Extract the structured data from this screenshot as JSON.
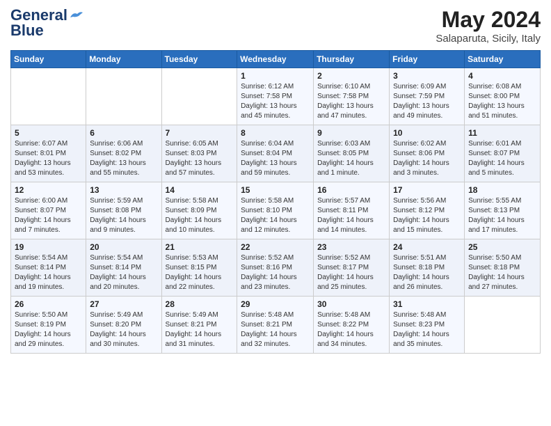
{
  "logo": {
    "line1": "General",
    "line2": "Blue"
  },
  "title": "May 2024",
  "subtitle": "Salaparuta, Sicily, Italy",
  "weekdays": [
    "Sunday",
    "Monday",
    "Tuesday",
    "Wednesday",
    "Thursday",
    "Friday",
    "Saturday"
  ],
  "weeks": [
    [
      {
        "day": "",
        "info": ""
      },
      {
        "day": "",
        "info": ""
      },
      {
        "day": "",
        "info": ""
      },
      {
        "day": "1",
        "info": "Sunrise: 6:12 AM\nSunset: 7:58 PM\nDaylight: 13 hours\nand 45 minutes."
      },
      {
        "day": "2",
        "info": "Sunrise: 6:10 AM\nSunset: 7:58 PM\nDaylight: 13 hours\nand 47 minutes."
      },
      {
        "day": "3",
        "info": "Sunrise: 6:09 AM\nSunset: 7:59 PM\nDaylight: 13 hours\nand 49 minutes."
      },
      {
        "day": "4",
        "info": "Sunrise: 6:08 AM\nSunset: 8:00 PM\nDaylight: 13 hours\nand 51 minutes."
      }
    ],
    [
      {
        "day": "5",
        "info": "Sunrise: 6:07 AM\nSunset: 8:01 PM\nDaylight: 13 hours\nand 53 minutes."
      },
      {
        "day": "6",
        "info": "Sunrise: 6:06 AM\nSunset: 8:02 PM\nDaylight: 13 hours\nand 55 minutes."
      },
      {
        "day": "7",
        "info": "Sunrise: 6:05 AM\nSunset: 8:03 PM\nDaylight: 13 hours\nand 57 minutes."
      },
      {
        "day": "8",
        "info": "Sunrise: 6:04 AM\nSunset: 8:04 PM\nDaylight: 13 hours\nand 59 minutes."
      },
      {
        "day": "9",
        "info": "Sunrise: 6:03 AM\nSunset: 8:05 PM\nDaylight: 14 hours\nand 1 minute."
      },
      {
        "day": "10",
        "info": "Sunrise: 6:02 AM\nSunset: 8:06 PM\nDaylight: 14 hours\nand 3 minutes."
      },
      {
        "day": "11",
        "info": "Sunrise: 6:01 AM\nSunset: 8:07 PM\nDaylight: 14 hours\nand 5 minutes."
      }
    ],
    [
      {
        "day": "12",
        "info": "Sunrise: 6:00 AM\nSunset: 8:07 PM\nDaylight: 14 hours\nand 7 minutes."
      },
      {
        "day": "13",
        "info": "Sunrise: 5:59 AM\nSunset: 8:08 PM\nDaylight: 14 hours\nand 9 minutes."
      },
      {
        "day": "14",
        "info": "Sunrise: 5:58 AM\nSunset: 8:09 PM\nDaylight: 14 hours\nand 10 minutes."
      },
      {
        "day": "15",
        "info": "Sunrise: 5:58 AM\nSunset: 8:10 PM\nDaylight: 14 hours\nand 12 minutes."
      },
      {
        "day": "16",
        "info": "Sunrise: 5:57 AM\nSunset: 8:11 PM\nDaylight: 14 hours\nand 14 minutes."
      },
      {
        "day": "17",
        "info": "Sunrise: 5:56 AM\nSunset: 8:12 PM\nDaylight: 14 hours\nand 15 minutes."
      },
      {
        "day": "18",
        "info": "Sunrise: 5:55 AM\nSunset: 8:13 PM\nDaylight: 14 hours\nand 17 minutes."
      }
    ],
    [
      {
        "day": "19",
        "info": "Sunrise: 5:54 AM\nSunset: 8:14 PM\nDaylight: 14 hours\nand 19 minutes."
      },
      {
        "day": "20",
        "info": "Sunrise: 5:54 AM\nSunset: 8:14 PM\nDaylight: 14 hours\nand 20 minutes."
      },
      {
        "day": "21",
        "info": "Sunrise: 5:53 AM\nSunset: 8:15 PM\nDaylight: 14 hours\nand 22 minutes."
      },
      {
        "day": "22",
        "info": "Sunrise: 5:52 AM\nSunset: 8:16 PM\nDaylight: 14 hours\nand 23 minutes."
      },
      {
        "day": "23",
        "info": "Sunrise: 5:52 AM\nSunset: 8:17 PM\nDaylight: 14 hours\nand 25 minutes."
      },
      {
        "day": "24",
        "info": "Sunrise: 5:51 AM\nSunset: 8:18 PM\nDaylight: 14 hours\nand 26 minutes."
      },
      {
        "day": "25",
        "info": "Sunrise: 5:50 AM\nSunset: 8:18 PM\nDaylight: 14 hours\nand 27 minutes."
      }
    ],
    [
      {
        "day": "26",
        "info": "Sunrise: 5:50 AM\nSunset: 8:19 PM\nDaylight: 14 hours\nand 29 minutes."
      },
      {
        "day": "27",
        "info": "Sunrise: 5:49 AM\nSunset: 8:20 PM\nDaylight: 14 hours\nand 30 minutes."
      },
      {
        "day": "28",
        "info": "Sunrise: 5:49 AM\nSunset: 8:21 PM\nDaylight: 14 hours\nand 31 minutes."
      },
      {
        "day": "29",
        "info": "Sunrise: 5:48 AM\nSunset: 8:21 PM\nDaylight: 14 hours\nand 32 minutes."
      },
      {
        "day": "30",
        "info": "Sunrise: 5:48 AM\nSunset: 8:22 PM\nDaylight: 14 hours\nand 34 minutes."
      },
      {
        "day": "31",
        "info": "Sunrise: 5:48 AM\nSunset: 8:23 PM\nDaylight: 14 hours\nand 35 minutes."
      },
      {
        "day": "",
        "info": ""
      }
    ]
  ]
}
